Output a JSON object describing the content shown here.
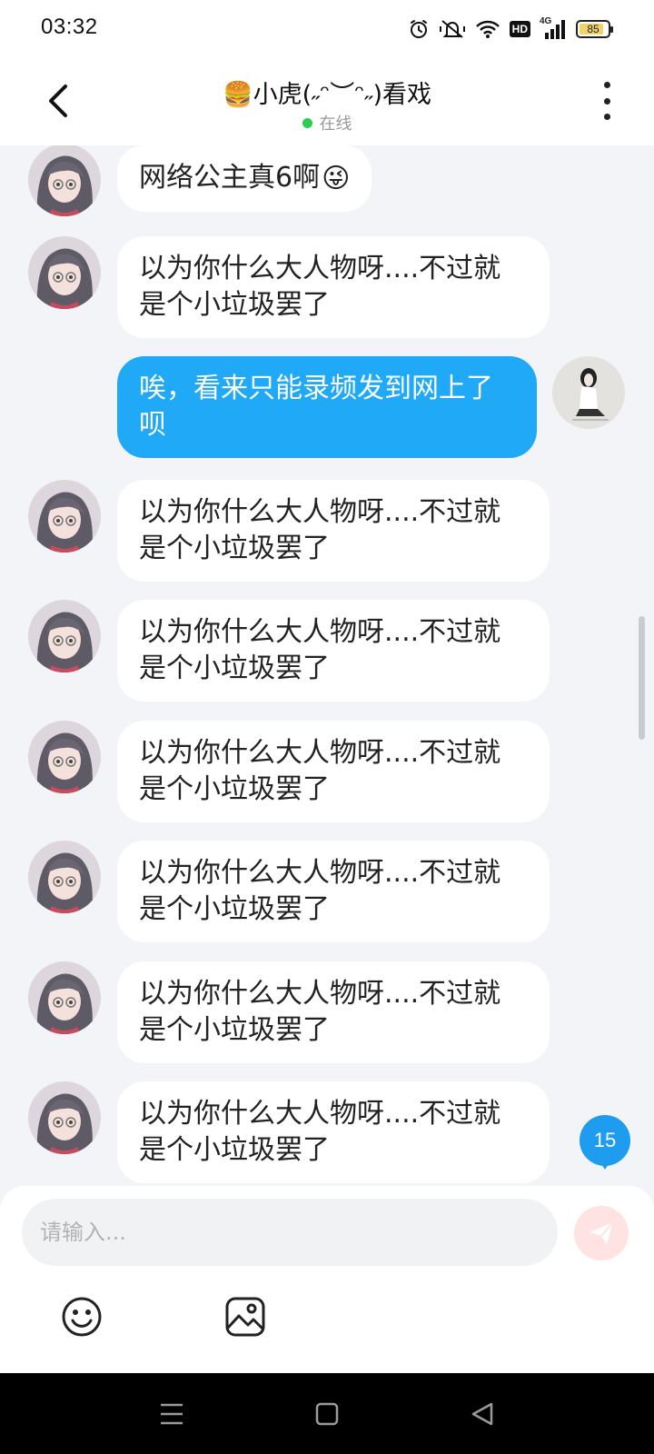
{
  "status_bar": {
    "time": "03:32",
    "battery": "85",
    "battery_level": 0.85,
    "network": "4G",
    "hd": "HD",
    "icons": [
      "alarm-icon",
      "silent-vibrate-icon",
      "wifi-icon",
      "hd-icon",
      "signal-4g-icon",
      "battery-icon"
    ]
  },
  "header": {
    "back_icon": "chevron-left-icon",
    "title": "🍔小虎(˶ᵔ︶ᵔ˶)看戏",
    "status": "在线",
    "status_color": "#2ecc4f",
    "more_icon": "more-vertical-icon"
  },
  "messages": [
    {
      "side": "in",
      "text": "网络公主真6啊",
      "emoji": "😜"
    },
    {
      "side": "in",
      "text": "以为你什么大人物呀....不过就是个小垃圾罢了"
    },
    {
      "side": "out",
      "text": "唉，看来只能录频发到网上了呗"
    },
    {
      "side": "in",
      "text": "以为你什么大人物呀....不过就是个小垃圾罢了"
    },
    {
      "side": "in",
      "text": "以为你什么大人物呀....不过就是个小垃圾罢了"
    },
    {
      "side": "in",
      "text": "以为你什么大人物呀....不过就是个小垃圾罢了"
    },
    {
      "side": "in",
      "text": "以为你什么大人物呀....不过就是个小垃圾罢了"
    },
    {
      "side": "in",
      "text": "以为你什么大人物呀....不过就是个小垃圾罢了"
    },
    {
      "side": "in",
      "text": "以为你什么大人物呀....不过就是个小垃圾罢了"
    }
  ],
  "unread_badge": "15",
  "input": {
    "placeholder": "请输入...",
    "value": ""
  },
  "toolbar": {
    "send_icon": "send-icon",
    "emoji_icon": "emoji-smile-icon",
    "image_icon": "image-icon"
  },
  "nav": {
    "icons": [
      "menu-icon",
      "home-square-icon",
      "back-triangle-icon"
    ]
  },
  "colors": {
    "accent": "#1fa9f7",
    "badge": "#1e9cf0",
    "background": "#f2f4f7",
    "send_disabled": "#ffe2e2"
  }
}
